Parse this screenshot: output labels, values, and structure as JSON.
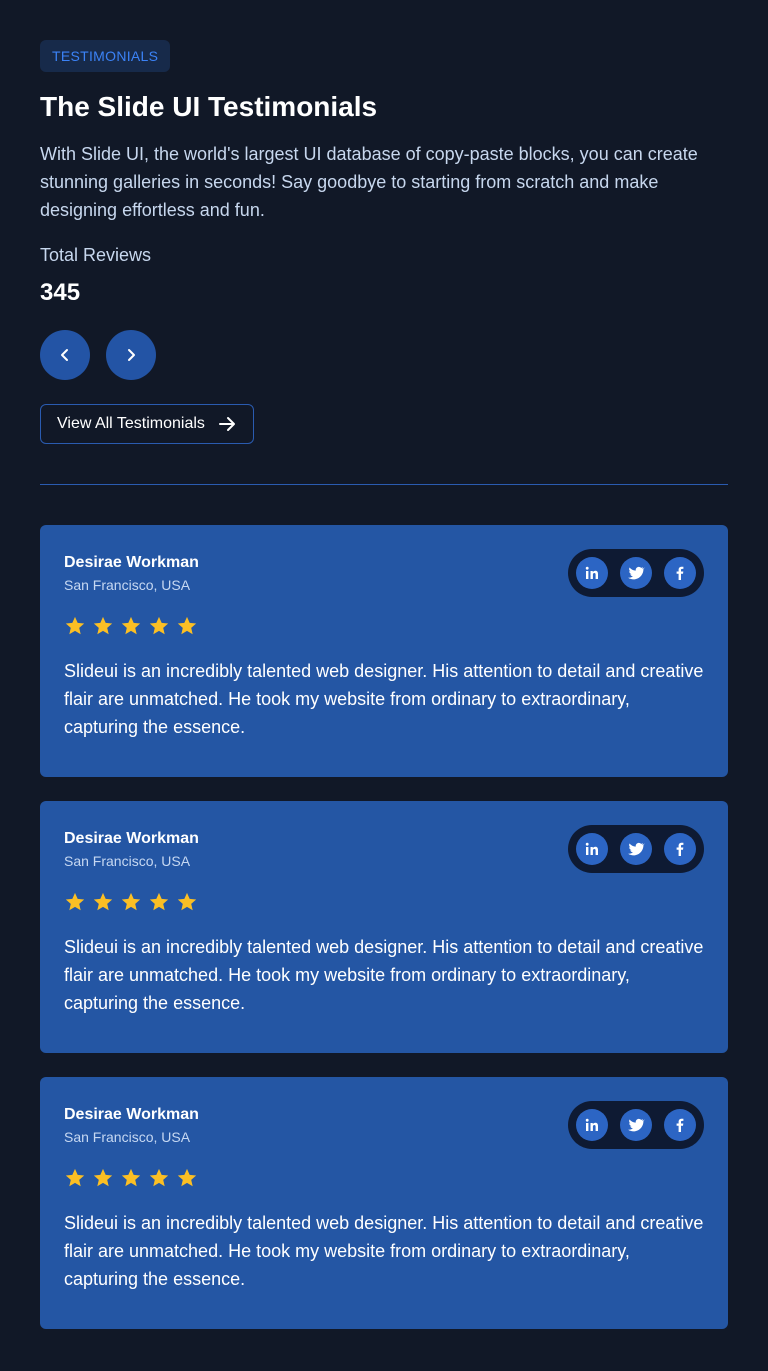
{
  "header": {
    "badge": "TESTIMONIALS",
    "title": "The Slide UI Testimonials",
    "description": "With Slide UI, the world's largest UI database of copy-paste blocks, you can create stunning galleries in seconds! Say goodbye to starting from scratch and make designing effortless and fun.",
    "total_label": "Total Reviews",
    "total_value": "345",
    "view_all_label": "View All Testimonials"
  },
  "colors": {
    "background": "#111827",
    "card": "#2456a4",
    "accent": "#3b82f6",
    "star": "#fbbf24"
  },
  "icons": {
    "prev": "chevron-left-icon",
    "next": "chevron-right-icon",
    "view_all": "arrow-right-icon",
    "social": [
      "linkedin-icon",
      "twitter-icon",
      "facebook-icon"
    ],
    "rating": "star-icon"
  },
  "testimonials": [
    {
      "name": "Desirae Workman",
      "location": "San Francisco, USA",
      "rating": 5,
      "quote": "Slideui is an incredibly talented web designer. His attention to detail and creative flair are unmatched. He took my website from ordinary to extraordinary, capturing the essence."
    },
    {
      "name": "Desirae Workman",
      "location": "San Francisco, USA",
      "rating": 5,
      "quote": "Slideui is an incredibly talented web designer. His attention to detail and creative flair are unmatched. He took my website from ordinary to extraordinary, capturing the essence."
    },
    {
      "name": "Desirae Workman",
      "location": "San Francisco, USA",
      "rating": 5,
      "quote": "Slideui is an incredibly talented web designer. His attention to detail and creative flair are unmatched. He took my website from ordinary to extraordinary, capturing the essence."
    }
  ]
}
